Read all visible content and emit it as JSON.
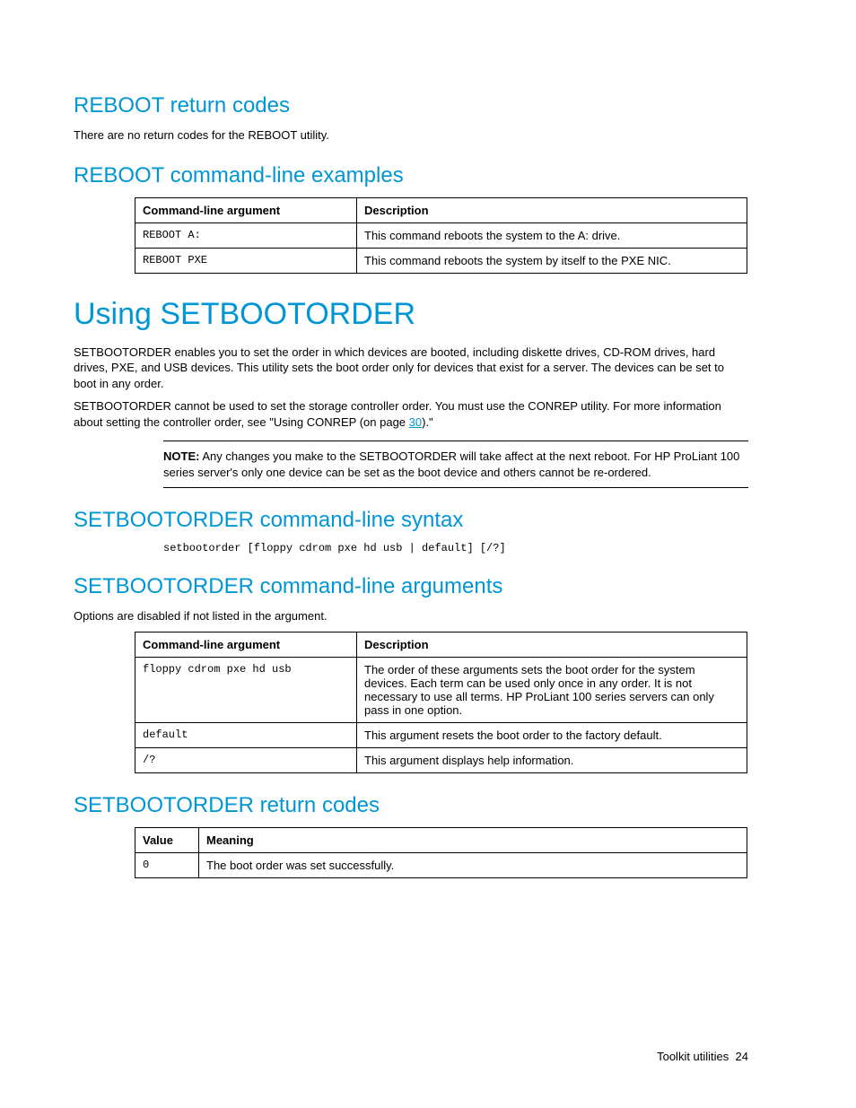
{
  "headings": {
    "reboot_retcodes": "REBOOT return codes",
    "reboot_examples": "REBOOT command-line examples",
    "using_setbootorder": "Using SETBOOTORDER",
    "sbo_syntax": "SETBOOTORDER command-line syntax",
    "sbo_args": "SETBOOTORDER command-line arguments",
    "sbo_retcodes": "SETBOOTORDER return codes"
  },
  "reboot_retcodes_text": "There are no return codes for the REBOOT utility.",
  "table_headers": {
    "arg": "Command-line argument",
    "desc": "Description",
    "value": "Value",
    "meaning": "Meaning"
  },
  "reboot_examples": [
    {
      "arg": "REBOOT A:",
      "desc": "This command reboots the system to the A: drive."
    },
    {
      "arg": "REBOOT PXE",
      "desc": "This command reboots the system by itself to the PXE NIC."
    }
  ],
  "sbo_intro1": "SETBOOTORDER enables you to set the order in which devices are booted, including diskette drives, CD-ROM drives, hard drives, PXE, and USB devices. This utility sets the boot order only for devices that exist for a server. The devices can be set to boot in any order.",
  "sbo_intro2_pre": "SETBOOTORDER cannot be used to set the storage controller order. You must use the CONREP utility. For more information about setting the controller order, see \"Using CONREP (on page ",
  "sbo_intro2_link": "30",
  "sbo_intro2_post": ").\"",
  "note_label": "NOTE:",
  "note_text": "Any changes you make to the SETBOOTORDER will take affect at the next reboot. For HP ProLiant 100 series server's only one device can be set as the boot device and others cannot be re-ordered.",
  "sbo_syntax_code": "setbootorder [floppy cdrom pxe hd usb | default] [/?]",
  "sbo_args_intro": "Options are disabled if not listed in the argument.",
  "sbo_args": [
    {
      "arg": "floppy cdrom pxe hd usb",
      "desc": "The order of these arguments sets the boot order for the system devices. Each term can be used only once in any order. It is not necessary to use all terms. HP ProLiant 100 series servers can only pass in one option."
    },
    {
      "arg": "default",
      "desc": "This argument resets the boot order to the factory default."
    },
    {
      "arg": "/?",
      "desc": "This argument displays help information."
    }
  ],
  "sbo_retcodes": [
    {
      "value": "0",
      "meaning": "The boot order was set successfully."
    }
  ],
  "footer": {
    "section": "Toolkit utilities",
    "page": "24"
  }
}
